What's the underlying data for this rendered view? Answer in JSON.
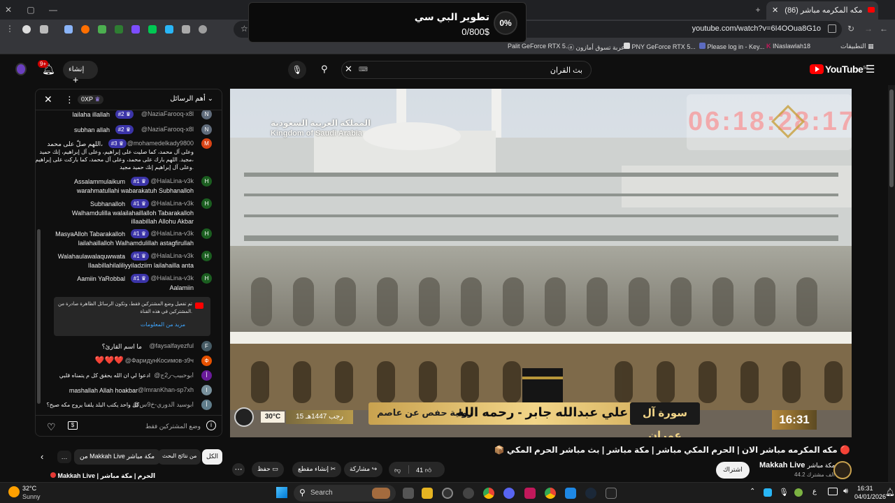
{
  "popup": {
    "title": "تطوير البي سي",
    "amount": "0/800$",
    "percent": "0%"
  },
  "browser": {
    "tab_title": "(86) مكه المكرمه مباشر",
    "url": "youtube.com/watch?v=6I4OOua8G1o",
    "bookmarks": [
      "Palit GeForce RTX 5...",
      "عربة تسوق أمازون",
      "PNY GeForce RTX 5...",
      "Please log in - Key...",
      "INaslawlah18",
      "التطبيقات"
    ]
  },
  "youtube": {
    "logo": "YouTube",
    "logo_region": "SA",
    "search_value": "بث القران",
    "create_label": "إنشاء",
    "notif_count": "9+"
  },
  "chat": {
    "header_label": "أهم الرسائل",
    "points_label": "0XP",
    "messages": [
      {
        "author": "@NaziaFarooq-x8l",
        "badge": "#2",
        "text": [
          "lailaha illallah"
        ],
        "avatar": "N",
        "color": "#5f6b7a"
      },
      {
        "author": "@NaziaFarooq-x8l",
        "badge": "#2",
        "text": [
          "subhan allah"
        ],
        "avatar": "N",
        "color": "#5f6b7a"
      },
      {
        "author": "@mohamedelkady9800",
        "badge": "#3",
        "text": [
          "اللهم صلّ على محمد،",
          "وعلى آل محمد، كما صليت على إبراهيم، وعلى آل إبراهيم، إنك حميد",
          "مجيد. اللهم بارك على محمد، وعلى آل محمد، كما باركت على إبراهيم،",
          "وعلى آل إبراهيم إنك حميد مجيد."
        ],
        "avatar": "M",
        "color": "#d84315"
      },
      {
        "author": "@HalaLina-v3k",
        "badge": "#1",
        "text": [
          "Assalammulaikum",
          "warahmatullahi wabarakatuh Subhanalloh"
        ],
        "avatar": "H",
        "color": "#1b5e20"
      },
      {
        "author": "@HalaLina-v3k",
        "badge": "#1",
        "text": [
          "Subhanalloh",
          "Walhamdulilla walailahaillalloh Tabarakalloh",
          "illaabillah Allohu Akbar"
        ],
        "avatar": "H",
        "color": "#1b5e20"
      },
      {
        "author": "@HalaLina-v3k",
        "badge": "#1",
        "text": [
          "MasyaAlloh Tabarakalloh",
          "lailahaillalloh Walhamdulillah astagfirullah"
        ],
        "avatar": "H",
        "color": "#1b5e20"
      },
      {
        "author": "@HalaLina-v3k",
        "badge": "#1",
        "text": [
          "Walahaulawalaquwwata",
          "Ilaabillahilaliliyyiladziim lailahailla anta"
        ],
        "avatar": "H",
        "color": "#1b5e20"
      },
      {
        "author": "@HalaLina-v3k",
        "badge": "#1",
        "text": [
          "Aamiin YaRobbal",
          "Aalamiin"
        ],
        "avatar": "H",
        "color": "#1b5e20"
      }
    ],
    "notice": {
      "text1": "تم تفعيل وضع المشتركين فقط، وتكون الرسائل الظاهرة صادرة من",
      "text2": "المشتركين في هذه القناة.",
      "link": "مزيد من المعلومات"
    },
    "messages2": [
      {
        "author": "@faysalfayezful",
        "text": "ما اسم القارئ؟",
        "avatar": "F",
        "color": "#455a64"
      },
      {
        "author": "@ФаридунКосимов-з9ч",
        "text": "❤️❤️❤️",
        "avatar": "Ф",
        "color": "#e65100"
      },
      {
        "author": "@ابوحبيب-ر2ج",
        "text": "ادعوا لي ان الله يحقق كل م يتمناه قلبي",
        "avatar": "أ",
        "color": "#6a1b9a"
      },
      {
        "author": "@ImranKhan-sp7xh",
        "text": "mashallah Allah hoakbar",
        "avatar": "I",
        "color": "#78909c"
      },
      {
        "author": "@ابوسيد الدوري-خ9س",
        "text": "كل واحد يكتب البلد يلفنا يروح مكه صيح؟",
        "avatar": "أ",
        "color": "#607d8b"
      }
    ],
    "footer_label": "وضع المشتركين فقط"
  },
  "video": {
    "clock": "06:18:28:17",
    "country_ar": "المملكة العربية السعودية",
    "country_en": "Kingdom of Saudi Arabia",
    "surah": "سورة آل عمران",
    "reciter": "القارئ : علي عبدالله جابر - رحمه الله",
    "narration": "رواية حفص عن عاصم",
    "hijri": "15 رجب 1447هـ",
    "temperature": "30°C",
    "time": "16:31"
  },
  "below": {
    "title": "📦 مكه المكرمه مباشر الان | الحرم المكي مباشر | مكة مباشر | بث مباشر الحرم المكي 🔴",
    "channel": "Makkah Live",
    "channel_prefix": "مكة مباشر",
    "subscribers": "44.2 ألف مشترك",
    "subscribe": "اشتراك",
    "likes": "41",
    "share": "مشاركة",
    "clip": "إنشاء مقطع",
    "save": "حفظ",
    "chips": [
      "الكل",
      "من نتائج البحث",
      "من Makkah Live مكة مباشر"
    ],
    "next_video": "Makkah Live | الحرم | مكة مباشر"
  },
  "taskbar": {
    "weather_temp": "32°C",
    "weather_label": "Sunny",
    "search": "Search",
    "time": "16:31",
    "date": "04/01/2026"
  }
}
